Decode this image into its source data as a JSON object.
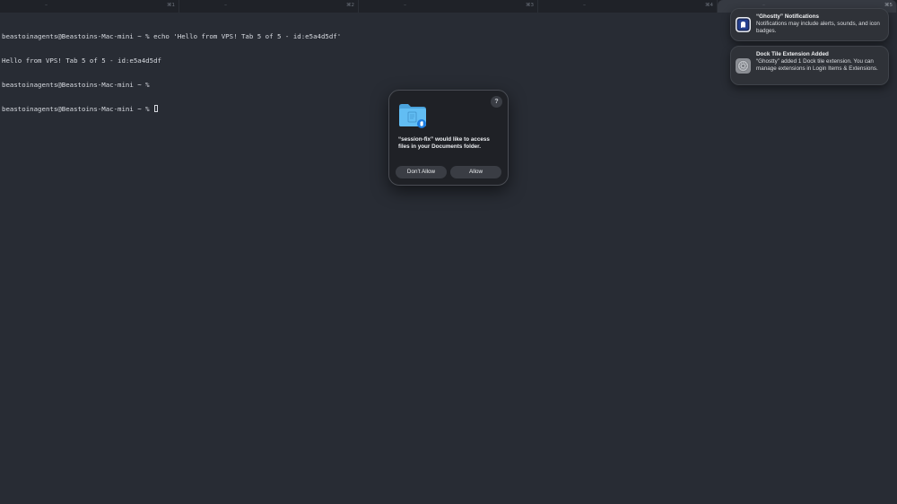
{
  "tabbar": {
    "tabs": [
      {
        "close_symbol": "–",
        "shortcut": "⌘1",
        "active": false
      },
      {
        "close_symbol": "–",
        "shortcut": "⌘2",
        "active": false
      },
      {
        "close_symbol": "–",
        "shortcut": "⌘3",
        "active": false
      },
      {
        "close_symbol": "–",
        "shortcut": "⌘4",
        "active": false
      },
      {
        "close_symbol": "–",
        "shortcut": "⌘5",
        "active": true
      }
    ]
  },
  "terminal": {
    "lines": [
      "beastoinagents@Beastoins-Mac-mini ~ % echo 'Hello from VPS! Tab 5 of 5 - id:e5a4d5df'",
      "Hello from VPS! Tab 5 of 5 - id:e5a4d5df",
      "beastoinagents@Beastoins-Mac-mini ~ %",
      "beastoinagents@Beastoins-Mac-mini ~ % "
    ]
  },
  "dialog": {
    "icon": "documents-folder-icon",
    "help_label": "?",
    "message": "“session-fix” would like to access files in your Documents folder.",
    "deny_label": "Don’t Allow",
    "allow_label": "Allow"
  },
  "notifications": [
    {
      "icon": "ghostty-app-icon",
      "title": "“Ghostty” Notifications",
      "body": "Notifications may include alerts, sounds, and icon badges."
    },
    {
      "icon": "system-settings-gear-icon",
      "title": "Dock Tile Extension Added",
      "body": "“Ghostty” added 1 Dock tile extension. You can manage extensions in Login Items & Extensions."
    }
  ],
  "colors": {
    "background": "#282c34",
    "tabbar": "#1f2228",
    "dialog": "#1f2126",
    "notification": "#2f3238",
    "folder_blue": "#5bb6f0"
  }
}
